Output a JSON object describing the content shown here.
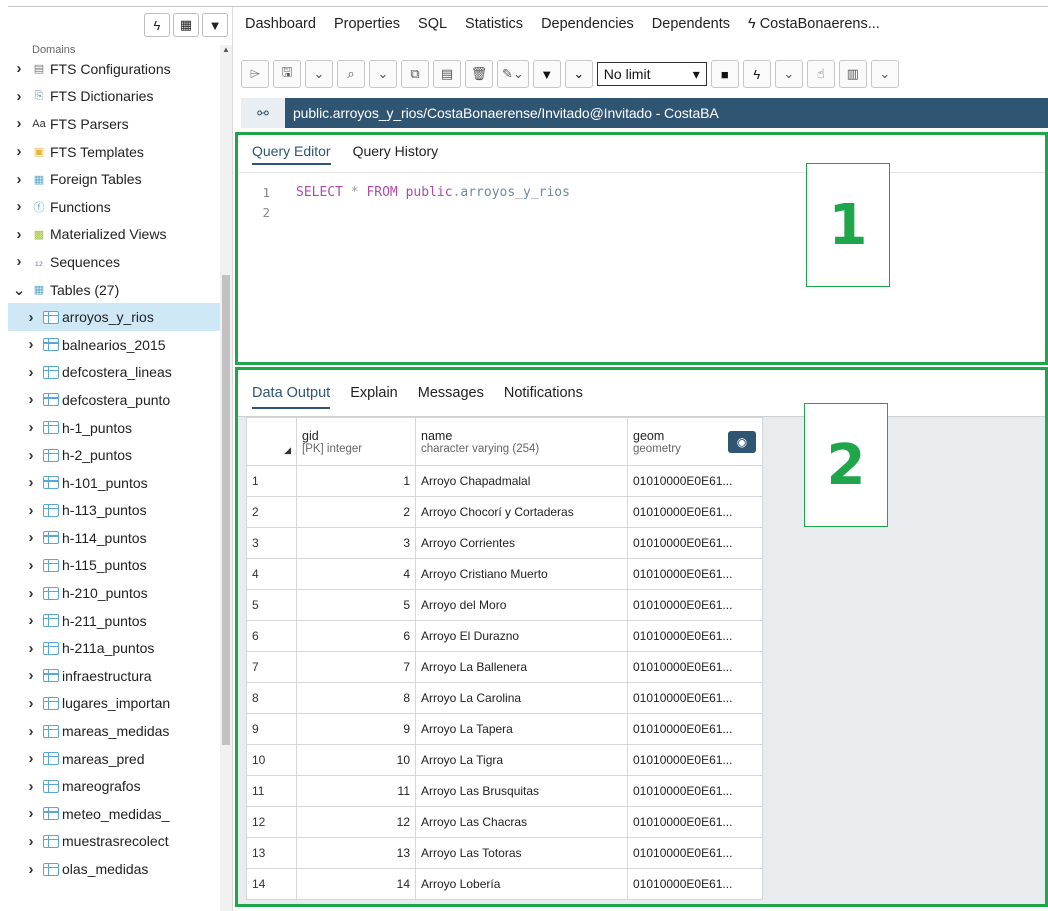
{
  "tree": {
    "partial_top": "Domains",
    "items": [
      {
        "label": "FTS Configurations",
        "icon": "fts-config-icon",
        "level": 0,
        "caret": ">"
      },
      {
        "label": "FTS Dictionaries",
        "icon": "fts-dictionary-icon",
        "level": 0,
        "caret": ">"
      },
      {
        "label": "FTS Parsers",
        "icon": "fts-parser-icon",
        "level": 0,
        "caret": ">"
      },
      {
        "label": "FTS Templates",
        "icon": "fts-template-icon",
        "level": 0,
        "caret": ">"
      },
      {
        "label": "Foreign Tables",
        "icon": "foreign-table-icon",
        "level": 0,
        "caret": ">"
      },
      {
        "label": "Functions",
        "icon": "function-icon",
        "level": 0,
        "caret": ">"
      },
      {
        "label": "Materialized Views",
        "icon": "materialized-view-icon",
        "level": 0,
        "caret": ">"
      },
      {
        "label": "Sequences",
        "icon": "sequence-icon",
        "level": 0,
        "caret": ">"
      },
      {
        "label": "Tables (27)",
        "icon": "tables-icon",
        "level": 0,
        "caret": "v"
      },
      {
        "label": "arroyos_y_rios",
        "icon": "table-icon",
        "level": 1,
        "caret": ">",
        "selected": true
      },
      {
        "label": "balnearios_2015",
        "icon": "table-icon",
        "level": 1,
        "caret": ">"
      },
      {
        "label": "defcostera_lineas",
        "icon": "table-icon",
        "level": 1,
        "caret": ">"
      },
      {
        "label": "defcostera_punto",
        "icon": "table-icon",
        "level": 1,
        "caret": ">"
      },
      {
        "label": "h-1_puntos",
        "icon": "table-icon",
        "level": 1,
        "caret": ">"
      },
      {
        "label": "h-2_puntos",
        "icon": "table-icon",
        "level": 1,
        "caret": ">"
      },
      {
        "label": "h-101_puntos",
        "icon": "table-icon",
        "level": 1,
        "caret": ">"
      },
      {
        "label": "h-113_puntos",
        "icon": "table-icon",
        "level": 1,
        "caret": ">"
      },
      {
        "label": "h-114_puntos",
        "icon": "table-icon",
        "level": 1,
        "caret": ">"
      },
      {
        "label": "h-115_puntos",
        "icon": "table-icon",
        "level": 1,
        "caret": ">"
      },
      {
        "label": "h-210_puntos",
        "icon": "table-icon",
        "level": 1,
        "caret": ">"
      },
      {
        "label": "h-211_puntos",
        "icon": "table-icon",
        "level": 1,
        "caret": ">"
      },
      {
        "label": "h-211a_puntos",
        "icon": "table-icon",
        "level": 1,
        "caret": ">"
      },
      {
        "label": "infraestructura",
        "icon": "table-icon",
        "level": 1,
        "caret": ">"
      },
      {
        "label": "lugares_importan",
        "icon": "table-icon",
        "level": 1,
        "caret": ">"
      },
      {
        "label": "mareas_medidas",
        "icon": "table-icon",
        "level": 1,
        "caret": ">"
      },
      {
        "label": "mareas_pred",
        "icon": "table-icon",
        "level": 1,
        "caret": ">"
      },
      {
        "label": "mareografos",
        "icon": "table-icon",
        "level": 1,
        "caret": ">"
      },
      {
        "label": "meteo_medidas_",
        "icon": "table-icon",
        "level": 1,
        "caret": ">"
      },
      {
        "label": "muestrasrecolect",
        "icon": "table-icon",
        "level": 1,
        "caret": ">"
      },
      {
        "label": "olas_medidas",
        "icon": "table-icon",
        "level": 1,
        "caret": ">"
      }
    ]
  },
  "tabs": [
    "Dashboard",
    "Properties",
    "SQL",
    "Statistics",
    "Dependencies",
    "Dependents",
    "CostaBonaerens..."
  ],
  "toolbar": {
    "limit_value": "No limit"
  },
  "connection": {
    "text": "public.arroyos_y_rios/CostaBonaerense/Invitado@Invitado - CostaBA"
  },
  "query_tabs": {
    "editor": "Query Editor",
    "history": "Query History"
  },
  "editor": {
    "line_numbers": [
      "1",
      "2"
    ],
    "kw_select": "SELECT",
    "star": "*",
    "kw_from": "FROM",
    "schema": "public",
    "dot": ".",
    "table": "arroyos_y_rios"
  },
  "output_tabs": [
    "Data Output",
    "Explain",
    "Messages",
    "Notifications"
  ],
  "grid": {
    "columns": [
      {
        "name": "gid",
        "type": "[PK] integer"
      },
      {
        "name": "name",
        "type": "character varying (254)"
      },
      {
        "name": "geom",
        "type": "geometry"
      }
    ],
    "rows": [
      {
        "n": "1",
        "gid": "1",
        "name": "Arroyo Chapadmalal",
        "geom": "01010000E0E61..."
      },
      {
        "n": "2",
        "gid": "2",
        "name": "Arroyo Chocorí y Cortaderas",
        "geom": "01010000E0E61..."
      },
      {
        "n": "3",
        "gid": "3",
        "name": "Arroyo Corrientes",
        "geom": "01010000E0E61..."
      },
      {
        "n": "4",
        "gid": "4",
        "name": "Arroyo Cristiano Muerto",
        "geom": "01010000E0E61..."
      },
      {
        "n": "5",
        "gid": "5",
        "name": "Arroyo del Moro",
        "geom": "01010000E0E61..."
      },
      {
        "n": "6",
        "gid": "6",
        "name": "Arroyo El Durazno",
        "geom": "01010000E0E61..."
      },
      {
        "n": "7",
        "gid": "7",
        "name": "Arroyo La Ballenera",
        "geom": "01010000E0E61..."
      },
      {
        "n": "8",
        "gid": "8",
        "name": "Arroyo La Carolina",
        "geom": "01010000E0E61..."
      },
      {
        "n": "9",
        "gid": "9",
        "name": "Arroyo La Tapera",
        "geom": "01010000E0E61..."
      },
      {
        "n": "10",
        "gid": "10",
        "name": "Arroyo La Tigra",
        "geom": "01010000E0E61..."
      },
      {
        "n": "11",
        "gid": "11",
        "name": "Arroyo Las Brusquitas",
        "geom": "01010000E0E61..."
      },
      {
        "n": "12",
        "gid": "12",
        "name": "Arroyo Las Chacras",
        "geom": "01010000E0E61..."
      },
      {
        "n": "13",
        "gid": "13",
        "name": "Arroyo Las Totoras",
        "geom": "01010000E0E61..."
      },
      {
        "n": "14",
        "gid": "14",
        "name": "Arroyo Lobería",
        "geom": "01010000E0E61..."
      }
    ]
  },
  "annotations": {
    "box1": "1",
    "box2": "2"
  },
  "colors": {
    "accent": "#2f5573",
    "annotation": "#1fa64a",
    "selection": "#cfe8f6"
  }
}
